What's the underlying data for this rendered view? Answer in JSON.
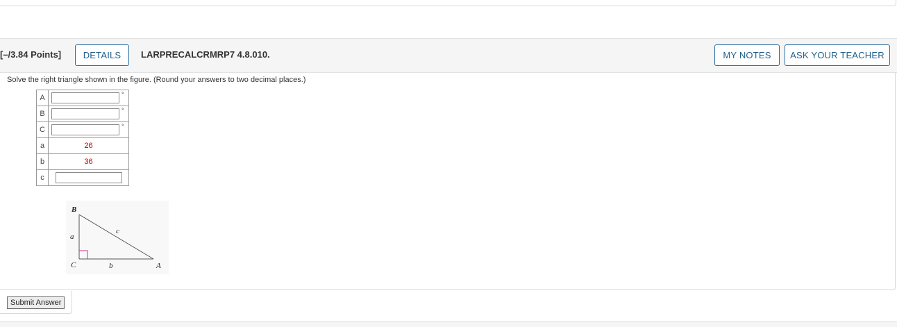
{
  "question": {
    "points": "[–/3.84 Points]",
    "details_label": "DETAILS",
    "problem_code": "LARPRECALCRMRP7 4.8.010.",
    "my_notes_label": "MY NOTES",
    "ask_teacher_label": "ASK YOUR TEACHER",
    "instructions": "Solve the right triangle shown in the figure. (Round your answers to two decimal places.)"
  },
  "answer_table": {
    "rows": [
      {
        "label": "A",
        "input_value": "",
        "unit": "°"
      },
      {
        "label": "B",
        "input_value": "",
        "unit": "°"
      },
      {
        "label": "C",
        "input_value": "",
        "unit": "°"
      },
      {
        "label": "a",
        "given": "26"
      },
      {
        "label": "b",
        "given": "36"
      },
      {
        "label": "c",
        "input_value": ""
      }
    ]
  },
  "figure": {
    "vertex_B": "B",
    "vertex_C": "C",
    "vertex_A": "A",
    "side_a": "a",
    "side_b": "b",
    "side_c": "c"
  },
  "submit_label": "Submit Answer",
  "colors": {
    "accent": "#1f5f8b",
    "given_value": "#c00000",
    "right_angle_marker": "#d0308a"
  }
}
